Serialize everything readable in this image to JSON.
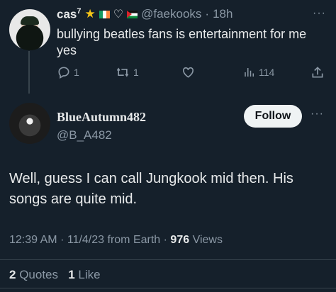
{
  "reply": {
    "display_name": "cas",
    "name_superscript": "7",
    "handle": "@faekooks",
    "time": "18h",
    "text": "bullying beatles fans is entertainment for me yes",
    "replies": "1",
    "retweets": "1",
    "views": "114"
  },
  "tweet": {
    "display_name": "BlueAutumn482",
    "handle": "@B_A482",
    "follow_label": "Follow",
    "text": "Well, guess I can call Jungkook mid then. His songs are quite mid.",
    "time": "12:39 AM",
    "date": "11/4/23",
    "source": "from Earth",
    "views_count": "976",
    "views_label": "Views",
    "quotes_count": "2",
    "quotes_label": "Quotes",
    "likes_count": "1",
    "likes_label": "Like"
  },
  "colors": {
    "background": "#15202b",
    "text": "#e7e9ea",
    "muted": "#8b98a5",
    "divider": "#38444d"
  },
  "icons": [
    "more-icon",
    "star-emoji",
    "ireland-flag",
    "heart-outline-emoji",
    "palestine-flag",
    "reply-icon",
    "retweet-icon",
    "like-icon",
    "views-icon",
    "share-icon"
  ]
}
